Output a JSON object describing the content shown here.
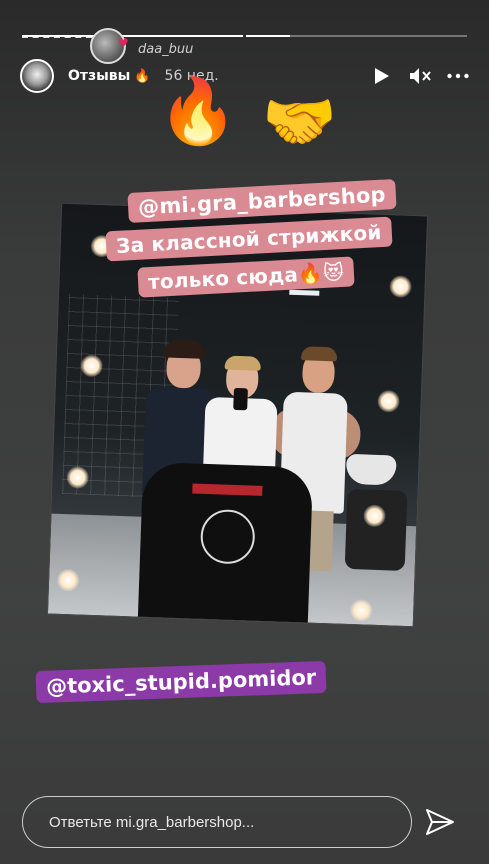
{
  "story": {
    "progress": [
      1.0,
      0.2
    ],
    "repost": {
      "username": "daa_buu"
    },
    "header": {
      "username": "Отзывы",
      "username_emoji": "🔥",
      "time": "56 нед."
    },
    "stickers": {
      "emoji_fire": "🔥",
      "emoji_handshake": "🤝",
      "mention_top": "@mi.gra_barbershop",
      "caption_line1": "За классной стрижкой",
      "caption_line2": "только сюда🔥😻",
      "mention_bottom": "@toxic_stupid.pomidor"
    },
    "reply": {
      "placeholder": "Ответьте mi.gra_barbershop..."
    },
    "icons": [
      "play-icon",
      "mute-icon",
      "more-icon",
      "send-icon"
    ]
  }
}
